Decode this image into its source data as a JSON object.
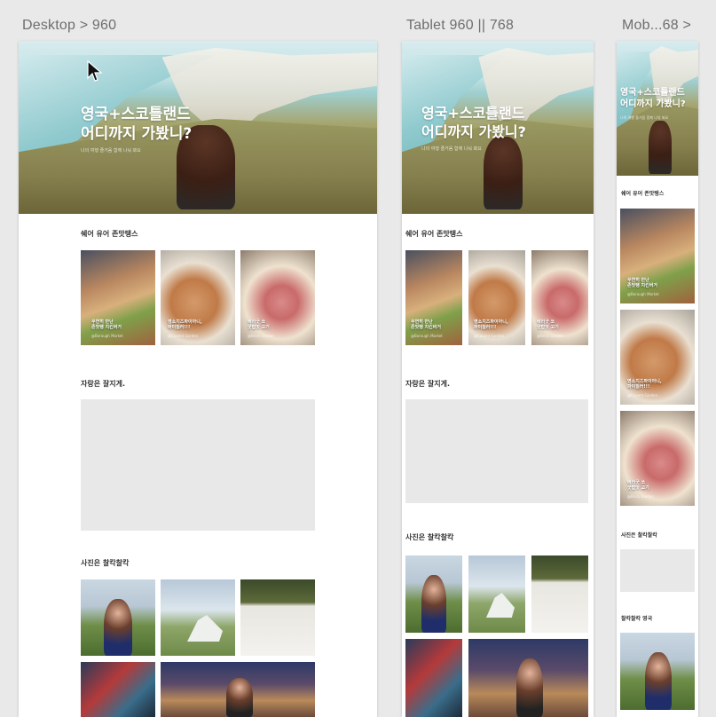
{
  "frames": {
    "desktop_label": "Desktop > 960",
    "tablet_label": "Tablet 960 || 768",
    "mobile_label": "Mob...68 >"
  },
  "hero": {
    "title_line1": "영국+스코틀랜드",
    "title_line2": "어디까지 가봤니?",
    "subtitle": "나의 여행 즐거움 함께 나눠 봐요"
  },
  "sections": {
    "food_title": "쉐어 유어 존맛탱스",
    "map_title": "자랑은 잘지게.",
    "photo_title": "사진은 찰칵찰칵",
    "mobile_map_title": "사진은 찰칵찰칵",
    "mobile_photo_title": "찰칵찰칵 영국"
  },
  "food_cards": [
    {
      "caption": "우연히 만난\n존맛탱 치킨버거",
      "location": "@Borough Market"
    },
    {
      "caption": "영소치즈파이아니,\n파이질러!!!",
      "location": "@Covent Garden"
    },
    {
      "caption": "베리굿 쏘\n굿밥맛 고기",
      "location": "@Brick Garden"
    }
  ],
  "colors": {
    "background": "#e9e9e9",
    "artboard": "#ffffff",
    "placeholder": "#e8e8e8"
  }
}
